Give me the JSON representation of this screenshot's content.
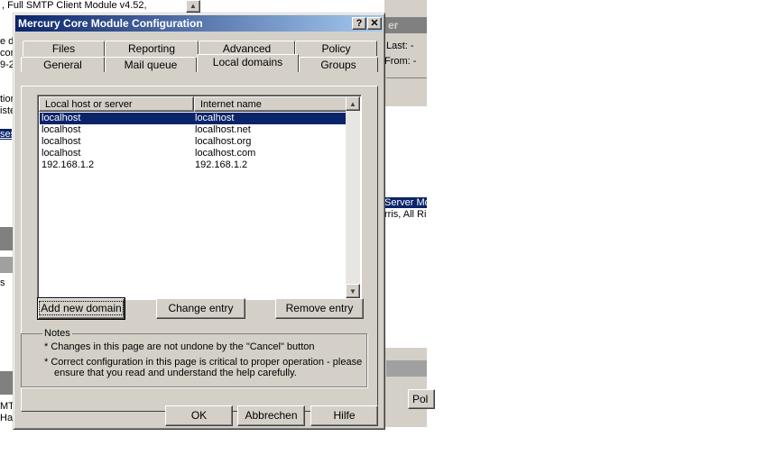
{
  "background": {
    "left_text_lines": [
      ", Full SMTP Client Module v4.52,",
      "e d",
      "cor",
      "9-2",
      "tion",
      "iste",
      "ses",
      "s",
      "MT",
      "Har"
    ],
    "right_lines": {
      "last_label": "Last:",
      "last_value": "-",
      "from_label": "From:",
      "from_value": "-",
      "title_partial": "er",
      "server_line": "Server Mo",
      "rights_line": "rris, All Rig"
    },
    "bottom_right_button": "Pol"
  },
  "dialog": {
    "title": "Mercury Core Module Configuration",
    "help_button": "?",
    "close_button": "✕",
    "tabs_back_row": [
      "Files",
      "Reporting",
      "Advanced",
      "Policy"
    ],
    "tabs_front_row": [
      "General",
      "Mail queue",
      "Local domains",
      "Groups"
    ],
    "active_tab": "Local domains",
    "list": {
      "columns": [
        "Local host or server",
        "Internet name"
      ],
      "rows": [
        {
          "host": "localhost",
          "internet": "localhost",
          "selected": true
        },
        {
          "host": "localhost",
          "internet": "localhost.net",
          "selected": false
        },
        {
          "host": "localhost",
          "internet": "localhost.org",
          "selected": false
        },
        {
          "host": "localhost",
          "internet": "localhost.com",
          "selected": false
        },
        {
          "host": "192.168.1.2",
          "internet": "192.168.1.2",
          "selected": false
        }
      ]
    },
    "buttons": {
      "add": "Add new domain",
      "change": "Change entry",
      "remove": "Remove entry"
    },
    "notes": {
      "legend": "Notes",
      "items": [
        "* Changes in this page are not undone by the \"Cancel\" button",
        "* Correct configuration in this page is critical to proper operation - please",
        "ensure that you read and understand the help carefully."
      ]
    },
    "footer": {
      "ok": "OK",
      "cancel": "Abbrechen",
      "help": "Hilfe"
    }
  }
}
